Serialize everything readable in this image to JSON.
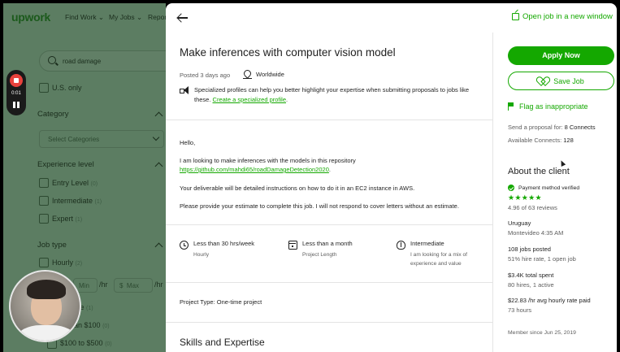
{
  "background_page": {
    "logo": "upwork",
    "nav": [
      "Find Work ⌄",
      "My Jobs ⌄",
      "Repor"
    ],
    "search_value": "road damage",
    "us_only": "U.S. only",
    "category_heading": "Category",
    "category_placeholder": "Select Categories",
    "experience_heading": "Experience level",
    "experience_items": [
      {
        "label": "Entry Level",
        "count": "(0)"
      },
      {
        "label": "Intermediate",
        "count": "(1)"
      },
      {
        "label": "Expert",
        "count": "(1)"
      }
    ],
    "job_type_heading": "Job type",
    "hourly": {
      "label": "Hourly",
      "count": "(2)"
    },
    "rate_min_placeholder": "Min",
    "rate_max_placeholder": "Max",
    "rate_unit": "/hr",
    "currency": "$",
    "fixed_fragment": "ice",
    "fixed_fragment_count": "(1)",
    "budget_items": [
      "han $100",
      "$100 to $500"
    ],
    "budget_counts": [
      "(0)",
      "(0)"
    ]
  },
  "recording": {
    "time": "0:01"
  },
  "panel": {
    "open_new_window": "Open job in a new window",
    "title": "Make inferences with computer vision model",
    "posted": "Posted 3 days ago",
    "location": "Worldwide",
    "tip_text": "Specialized profiles can help you better highlight your expertise when submitting proposals to jobs like these.",
    "tip_link": "Create a specialized profile",
    "tip_end": ".",
    "description": {
      "greeting": "Hello,",
      "line1": "I am looking to make inferences with the models in this repository",
      "repo_link": "https://github.com/mahdi65/roadDamageDetection2020",
      "repo_end": ".",
      "line2": "Your deliverable will be detailed instructions on how to do it in an EC2 instance in AWS.",
      "line3": "Please provide your estimate to complete this job. I will not respond to cover letters without an estimate."
    },
    "features": [
      {
        "title": "Less than 30 hrs/week",
        "sub": "Hourly",
        "icon": "clock-icon"
      },
      {
        "title": "Less than a month",
        "sub": "Project Length",
        "icon": "calendar-icon"
      },
      {
        "title": "Intermediate",
        "sub": "I am looking for a mix of experience and value",
        "icon": "brain-icon"
      }
    ],
    "project_type_label": "Project Type:",
    "project_type_value": "One-time project",
    "skills_heading": "Skills and Expertise"
  },
  "sidebar": {
    "apply_label": "Apply Now",
    "save_label": "Save Job",
    "flag_label": "Flag as inappropriate",
    "send_proposal_label": "Send a proposal for:",
    "send_proposal_value": "8 Connects",
    "available_label": "Available Connects:",
    "available_value": "128",
    "about_heading": "About the client",
    "payment_verified": "Payment method verified",
    "stars": "★★★★★",
    "rating_text": "4.96 of 63 reviews",
    "country": "Uruguay",
    "city_time": "Montevideo 4:35 AM",
    "jobs_posted": "108 jobs posted",
    "hire_rate": "51% hire rate, 1 open job",
    "total_spent": "$3.4K total spent",
    "hours": "80 hires, 1 active",
    "avg_rate": "$22.83 /hr avg hourly rate paid",
    "total_hours": "73 hours",
    "member_since": "Member since Jun 25, 2019"
  },
  "colors": {
    "accent": "#14a800",
    "dim_overlay": "#5c7d62"
  }
}
